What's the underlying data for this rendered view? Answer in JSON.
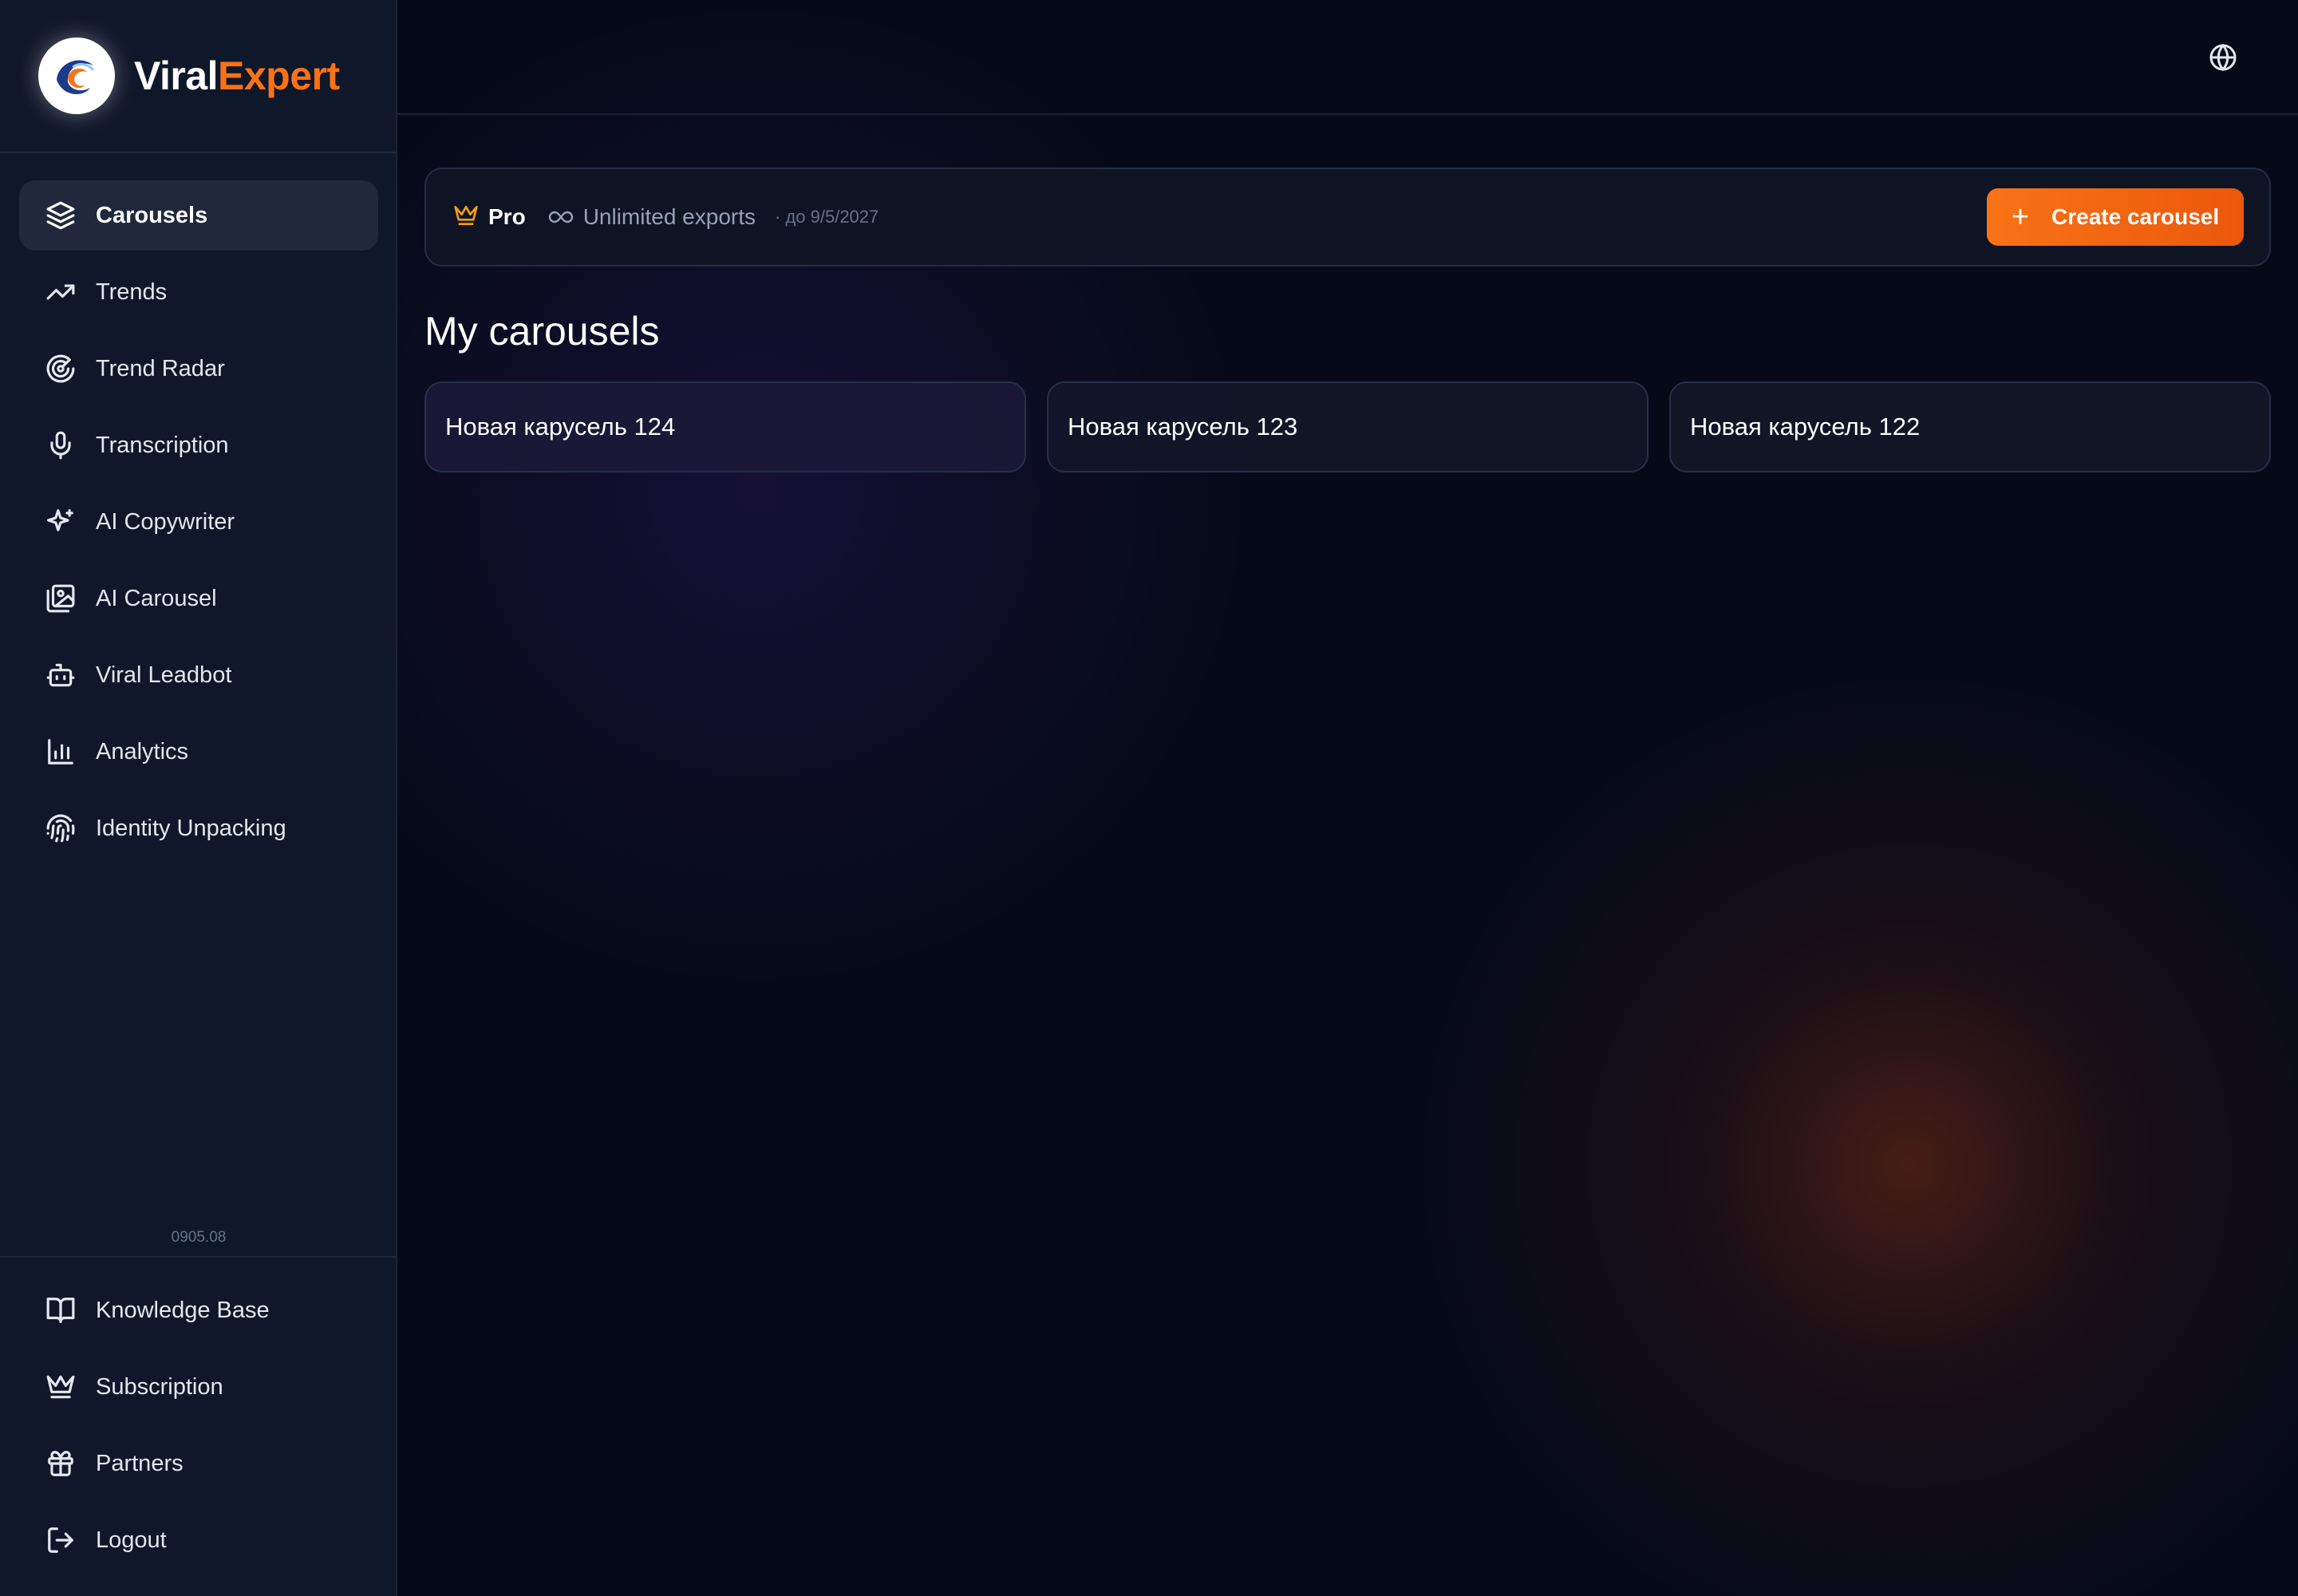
{
  "brand": {
    "name_part1": "Viral",
    "name_part2": "Expert",
    "accent": "#f97316"
  },
  "sidebar": {
    "items": [
      {
        "label": "Carousels",
        "icon": "layers-icon",
        "active": true
      },
      {
        "label": "Trends",
        "icon": "trending-up-icon"
      },
      {
        "label": "Trend Radar",
        "icon": "radar-icon"
      },
      {
        "label": "Transcription",
        "icon": "microphone-icon"
      },
      {
        "label": "AI Copywriter",
        "icon": "sparkles-icon"
      },
      {
        "label": "AI Carousel",
        "icon": "images-icon"
      },
      {
        "label": "Viral Leadbot",
        "icon": "bot-icon"
      },
      {
        "label": "Analytics",
        "icon": "bar-chart-icon"
      },
      {
        "label": "Identity Unpacking",
        "icon": "fingerprint-icon"
      }
    ],
    "version": "0905.08",
    "bottom_items": [
      {
        "label": "Knowledge Base",
        "icon": "book-open-icon"
      },
      {
        "label": "Subscription",
        "icon": "crown-icon"
      },
      {
        "label": "Partners",
        "icon": "gift-icon"
      },
      {
        "label": "Logout",
        "icon": "logout-icon"
      }
    ]
  },
  "topbar": {
    "language_icon": "globe-icon"
  },
  "plan": {
    "name": "Pro",
    "exports": "Unlimited exports",
    "until": "· до 9/5/2027",
    "create_label": "Create carousel"
  },
  "main": {
    "title": "My carousels",
    "carousels": [
      {
        "title": "Новая карусель 124"
      },
      {
        "title": "Новая карусель 123"
      },
      {
        "title": "Новая карусель 122"
      }
    ]
  }
}
